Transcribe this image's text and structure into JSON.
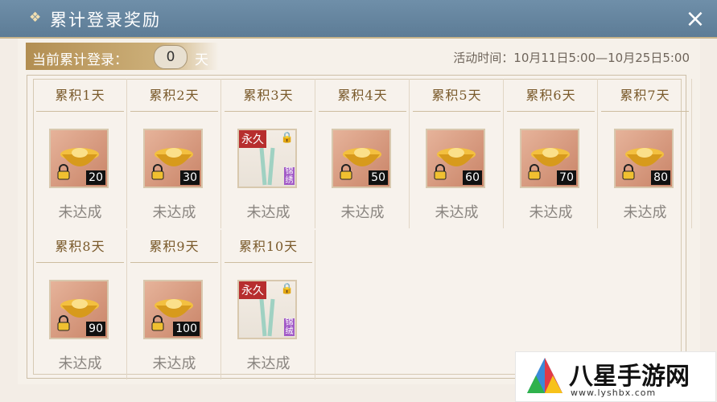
{
  "header": {
    "icon": "diamond-icon",
    "title": "累计登录奖励",
    "close": "×"
  },
  "login": {
    "label": "当前累计登录：",
    "days": "0",
    "unit": "天"
  },
  "activity_time": "活动时间：10月11日5:00—10月25日5:00",
  "cells": [
    {
      "title": "累积1天",
      "type": "ingot",
      "qty": "20",
      "status": "未达成"
    },
    {
      "title": "累积2天",
      "type": "ingot",
      "qty": "30",
      "status": "未达成"
    },
    {
      "title": "累积3天",
      "type": "outfit",
      "perm": "永久",
      "side": "锦绣",
      "status": "未达成"
    },
    {
      "title": "累积4天",
      "type": "ingot",
      "qty": "50",
      "status": "未达成"
    },
    {
      "title": "累积5天",
      "type": "ingot",
      "qty": "60",
      "status": "未达成"
    },
    {
      "title": "累积6天",
      "type": "ingot",
      "qty": "70",
      "status": "未达成"
    },
    {
      "title": "累积7天",
      "type": "ingot",
      "qty": "80",
      "status": "未达成"
    },
    {
      "title": "累积8天",
      "type": "ingot",
      "qty": "90",
      "status": "未达成"
    },
    {
      "title": "累积9天",
      "type": "ingot",
      "qty": "100",
      "status": "未达成"
    },
    {
      "title": "累积10天",
      "type": "outfit",
      "perm": "永久",
      "side": "锦绒",
      "status": "未达成"
    }
  ],
  "watermark": {
    "title": "八星手游网",
    "url": "www.lyshbx.com"
  },
  "colors": {
    "header": "#6f8fa9",
    "gold": "#b28e52",
    "status": "#8a8580"
  }
}
